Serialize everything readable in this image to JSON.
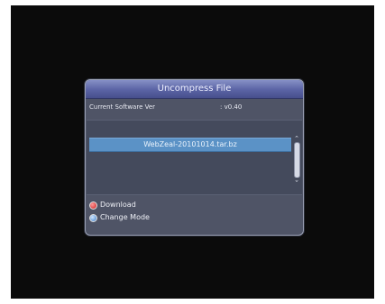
{
  "dialog": {
    "title": "Uncompress File",
    "info_label": "Current Software Ver",
    "info_value": ": v0.40"
  },
  "file_list": {
    "items": [
      "WebZeal-20101014.tar.bz"
    ],
    "selected_index": 0
  },
  "legend": {
    "download_label": "Download",
    "change_mode_label": "Change Mode"
  },
  "colors": {
    "selection": "#5b92c6",
    "title_bar": "#5a63a4",
    "download_key": "#cc1f1f",
    "change_mode_key": "#3f7fc9"
  }
}
